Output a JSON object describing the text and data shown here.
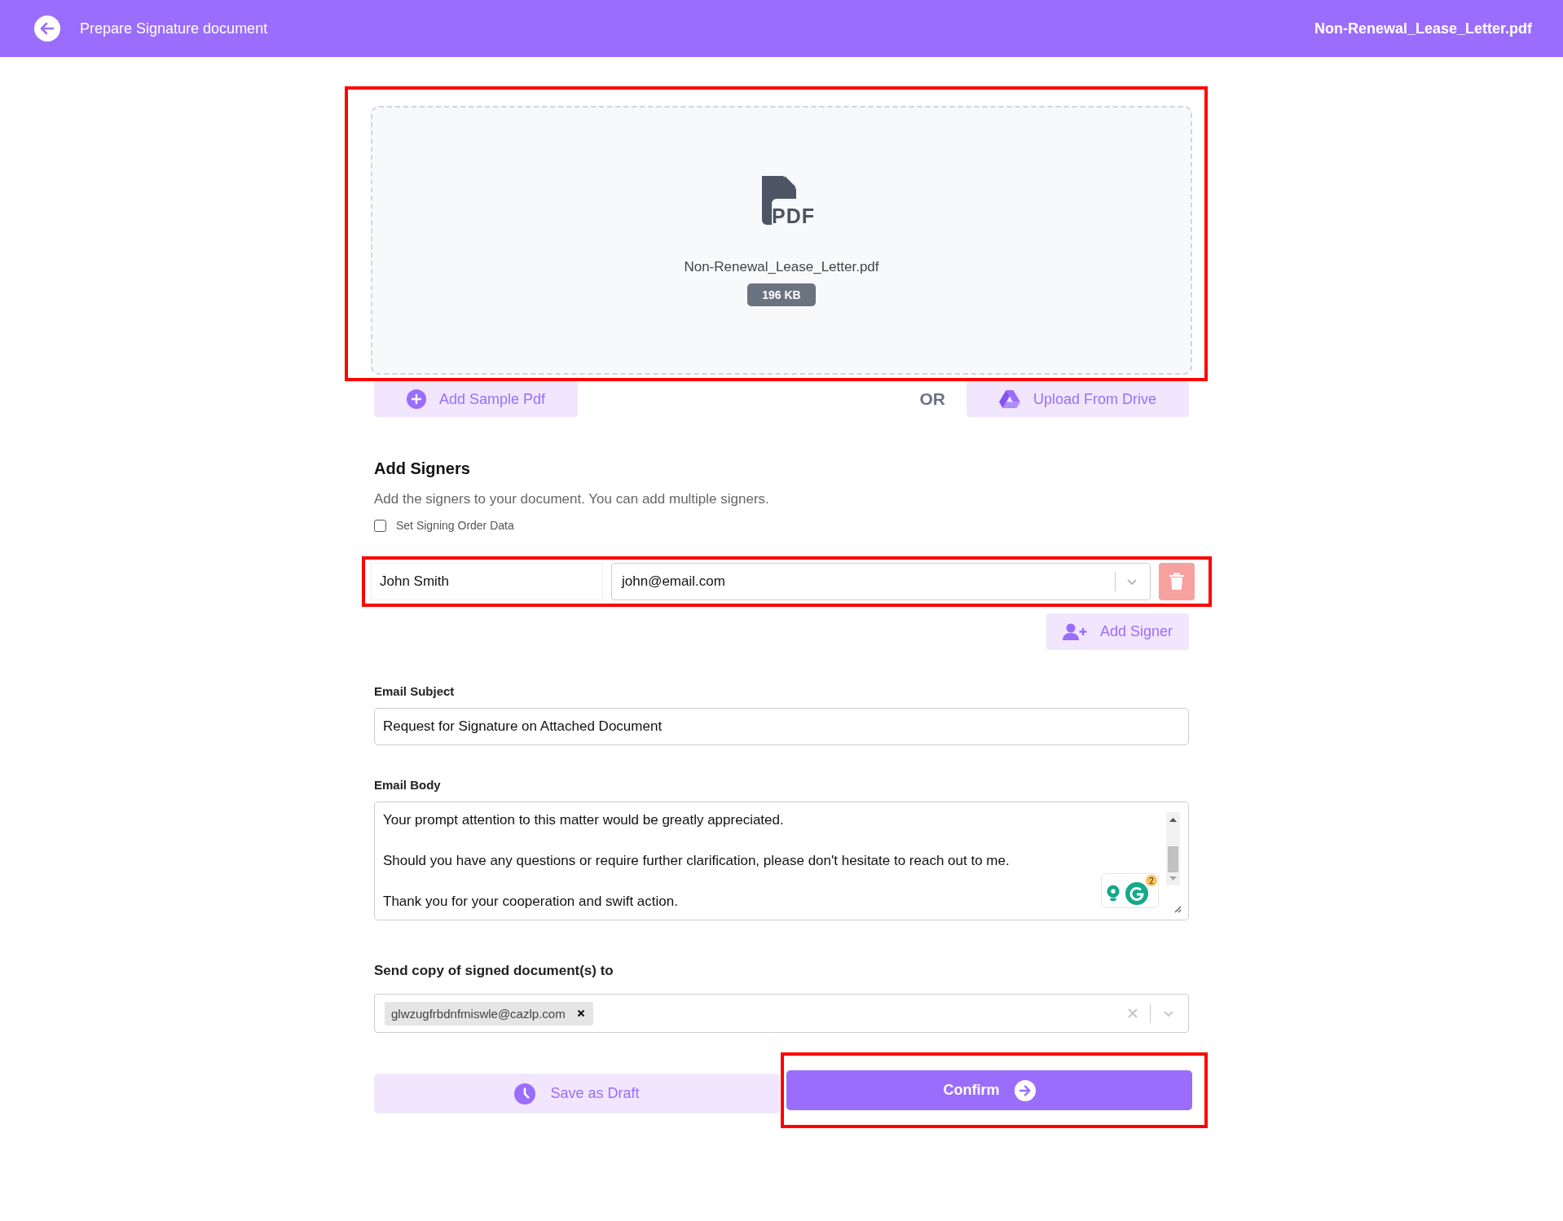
{
  "header": {
    "title": "Prepare Signature document",
    "file_name": "Non-Renewal_Lease_Letter.pdf"
  },
  "upload": {
    "highlighted": true,
    "file_type": "PDF",
    "file_name": "Non-Renewal_Lease_Letter.pdf",
    "size": "196 KB"
  },
  "source_buttons": [
    {
      "label": "Add Sample Pdf",
      "kind": "sample"
    },
    {
      "label": "Upload From Drive",
      "kind": "drive"
    }
  ],
  "or_text": "OR",
  "signers_section": {
    "title": "Add Signers",
    "description": "Add the signers to your document. You can add multiple signers.",
    "signing_order": {
      "label": "Set Signing Order Data",
      "checked": false
    }
  },
  "signers": [
    {
      "name": "John Smith",
      "email": "john@email.com",
      "highlighted": true
    }
  ],
  "add_signer_button": "Add Signer",
  "email_subject": {
    "label": "Email Subject",
    "value": "Request for Signature on Attached Document"
  },
  "email_body": {
    "label": "Email Body",
    "paragraphs": [
      "Your prompt attention to this matter would be greatly appreciated.",
      "Should you have any questions or require further clarification, please don't hesitate to reach out to me.",
      "Thank you for your cooperation and swift action."
    ],
    "assistant_badge": "2"
  },
  "copy_to": {
    "label": "Send copy of signed document(s) to",
    "tags": [
      "glwzugfrbdnfmiswle@cazlp.com"
    ]
  },
  "actions": [
    {
      "label": "Save as Draft",
      "kind": "draft",
      "highlighted": false
    },
    {
      "label": "Confirm",
      "kind": "confirm",
      "highlighted": true
    }
  ]
}
